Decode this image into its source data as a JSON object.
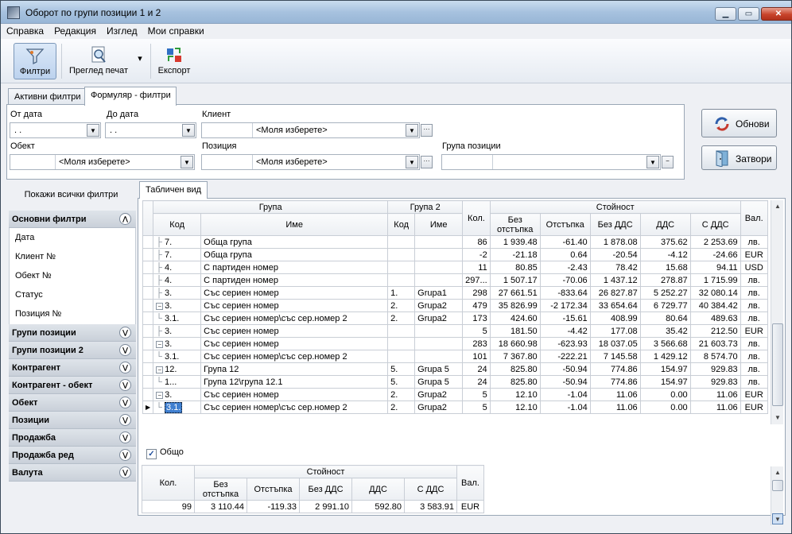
{
  "window": {
    "title": "Оборот по групи позиции 1 и 2"
  },
  "menu": [
    "Справка",
    "Редакция",
    "Изглед",
    "Мои справки"
  ],
  "toolbar": {
    "filters": "Филтри",
    "print_preview": "Преглед печат",
    "export": "Експорт"
  },
  "filter_tabs": {
    "active": "Активни филтри",
    "form": "Формуляр - филтри"
  },
  "filter_form": {
    "from_date_label": "От дата",
    "from_date_value": " .  .",
    "to_date_label": "До дата",
    "to_date_value": " .  .",
    "client_label": "Клиент",
    "client_placeholder": "<Моля изберете>",
    "object_label": "Обект",
    "object_placeholder": "<Моля изберете>",
    "position_label": "Позиция",
    "position_placeholder": "<Моля изберете>",
    "group_label": "Група позиции"
  },
  "buttons": {
    "refresh": "Обнови",
    "close": "Затвори"
  },
  "left": {
    "show_all": "Покажи всички филтри",
    "main_filters": "Основни филтри",
    "main_items": [
      "Дата",
      "Клиент №",
      "Обект №",
      "Статус",
      "Позиция №"
    ],
    "groups": [
      "Групи позиции",
      "Групи позиции 2",
      "Контрагент",
      "Контрагент - обект",
      "Обект",
      "Позиции",
      "Продажба",
      "Продажба ред",
      "Валута"
    ]
  },
  "grid": {
    "tab": "Табличен вид",
    "headers": {
      "group": "Група",
      "group2": "Група 2",
      "qty": "Кол.",
      "value": "Стойност",
      "currency": "Вал.",
      "code": "Код",
      "name": "Име",
      "code2": "Код",
      "name2": "Име",
      "no_discount": "Без отстъпка",
      "discount": "Отстъпка",
      "no_vat": "Без ДДС",
      "vat": "ДДС",
      "with_vat": "С ДДС"
    },
    "rows": [
      {
        "tree": "├",
        "code": "7.",
        "name": "Обща група",
        "code2": "",
        "name2": "",
        "qty": "86",
        "nodisc": "1 939.48",
        "disc": "-61.40",
        "novat": "1 878.08",
        "vat": "375.62",
        "withvat": "2 253.69",
        "cur": "лв."
      },
      {
        "tree": "├",
        "code": "7.",
        "name": "Обща група",
        "code2": "",
        "name2": "",
        "qty": "-2",
        "nodisc": "-21.18",
        "disc": "0.64",
        "novat": "-20.54",
        "vat": "-4.12",
        "withvat": "-24.66",
        "cur": "EUR"
      },
      {
        "tree": "├",
        "code": "4.",
        "name": "С партиден номер",
        "code2": "",
        "name2": "",
        "qty": "11",
        "nodisc": "80.85",
        "disc": "-2.43",
        "novat": "78.42",
        "vat": "15.68",
        "withvat": "94.11",
        "cur": "USD"
      },
      {
        "tree": "├",
        "code": "4.",
        "name": "С партиден номер",
        "code2": "",
        "name2": "",
        "qty": "297...",
        "nodisc": "1 507.17",
        "disc": "-70.06",
        "novat": "1 437.12",
        "vat": "278.87",
        "withvat": "1 715.99",
        "cur": "лв."
      },
      {
        "tree": "├",
        "code": "3.",
        "name": "Със сериен номер",
        "code2": "1.",
        "name2": "Grupa1",
        "qty": "298",
        "nodisc": "27 661.51",
        "disc": "-833.64",
        "novat": "26 827.87",
        "vat": "5 252.27",
        "withvat": "32 080.14",
        "cur": "лв."
      },
      {
        "tree": "⊟",
        "code": "3.",
        "name": "Със сериен номер",
        "code2": "2.",
        "name2": "Grupa2",
        "qty": "479",
        "nodisc": "35 826.99",
        "disc": "-2 172.34",
        "novat": "33 654.64",
        "vat": "6 729.77",
        "withvat": "40 384.42",
        "cur": "лв."
      },
      {
        "tree": "└",
        "code": "3.1.",
        "name": "Със сериен номер\\със сер.номер 2",
        "code2": "2.",
        "name2": "Grupa2",
        "qty": "173",
        "nodisc": "424.60",
        "disc": "-15.61",
        "novat": "408.99",
        "vat": "80.64",
        "withvat": "489.63",
        "cur": "лв."
      },
      {
        "tree": "├",
        "code": "3.",
        "name": "Със сериен номер",
        "code2": "",
        "name2": "",
        "qty": "5",
        "nodisc": "181.50",
        "disc": "-4.42",
        "novat": "177.08",
        "vat": "35.42",
        "withvat": "212.50",
        "cur": "EUR"
      },
      {
        "tree": "⊟",
        "code": "3.",
        "name": "Със сериен номер",
        "code2": "",
        "name2": "",
        "qty": "283",
        "nodisc": "18 660.98",
        "disc": "-623.93",
        "novat": "18 037.05",
        "vat": "3 566.68",
        "withvat": "21 603.73",
        "cur": "лв."
      },
      {
        "tree": "└",
        "code": "3.1.",
        "name": "Със сериен номер\\със сер.номер 2",
        "code2": "",
        "name2": "",
        "qty": "101",
        "nodisc": "7 367.80",
        "disc": "-222.21",
        "novat": "7 145.58",
        "vat": "1 429.12",
        "withvat": "8 574.70",
        "cur": "лв."
      },
      {
        "tree": "⊟",
        "code": "12.",
        "name": "Група 12",
        "code2": "5.",
        "name2": "Grupa 5",
        "qty": "24",
        "nodisc": "825.80",
        "disc": "-50.94",
        "novat": "774.86",
        "vat": "154.97",
        "withvat": "929.83",
        "cur": "лв."
      },
      {
        "tree": "└",
        "code": "1...",
        "name": "Група 12\\група 12.1",
        "code2": "5.",
        "name2": "Grupa 5",
        "qty": "24",
        "nodisc": "825.80",
        "disc": "-50.94",
        "novat": "774.86",
        "vat": "154.97",
        "withvat": "929.83",
        "cur": "лв."
      },
      {
        "tree": "⊟",
        "code": "3.",
        "name": "Със сериен номер",
        "code2": "2.",
        "name2": "Grupa2",
        "qty": "5",
        "nodisc": "12.10",
        "disc": "-1.04",
        "novat": "11.06",
        "vat": "0.00",
        "withvat": "11.06",
        "cur": "EUR"
      },
      {
        "tree": "└",
        "code": "3.1.",
        "name": "Със сериен номер\\със сер.номер 2",
        "code2": "2.",
        "name2": "Grupa2",
        "qty": "5",
        "nodisc": "12.10",
        "disc": "-1.04",
        "novat": "11.06",
        "vat": "0.00",
        "withvat": "11.06",
        "cur": "EUR"
      }
    ]
  },
  "total": {
    "label": "Общо",
    "headers": {
      "qty": "Кол.",
      "value": "Стойност",
      "no_discount": "Без отстъпка",
      "discount": "Отстъпка",
      "no_vat": "Без ДДС",
      "vat": "ДДС",
      "with_vat": "С ДДС",
      "currency": "Вал."
    },
    "row": {
      "qty": "99",
      "nodisc": "3 110.44",
      "disc": "-119.33",
      "novat": "2 991.10",
      "vat": "592.80",
      "withvat": "3 583.91",
      "cur": "EUR"
    }
  }
}
